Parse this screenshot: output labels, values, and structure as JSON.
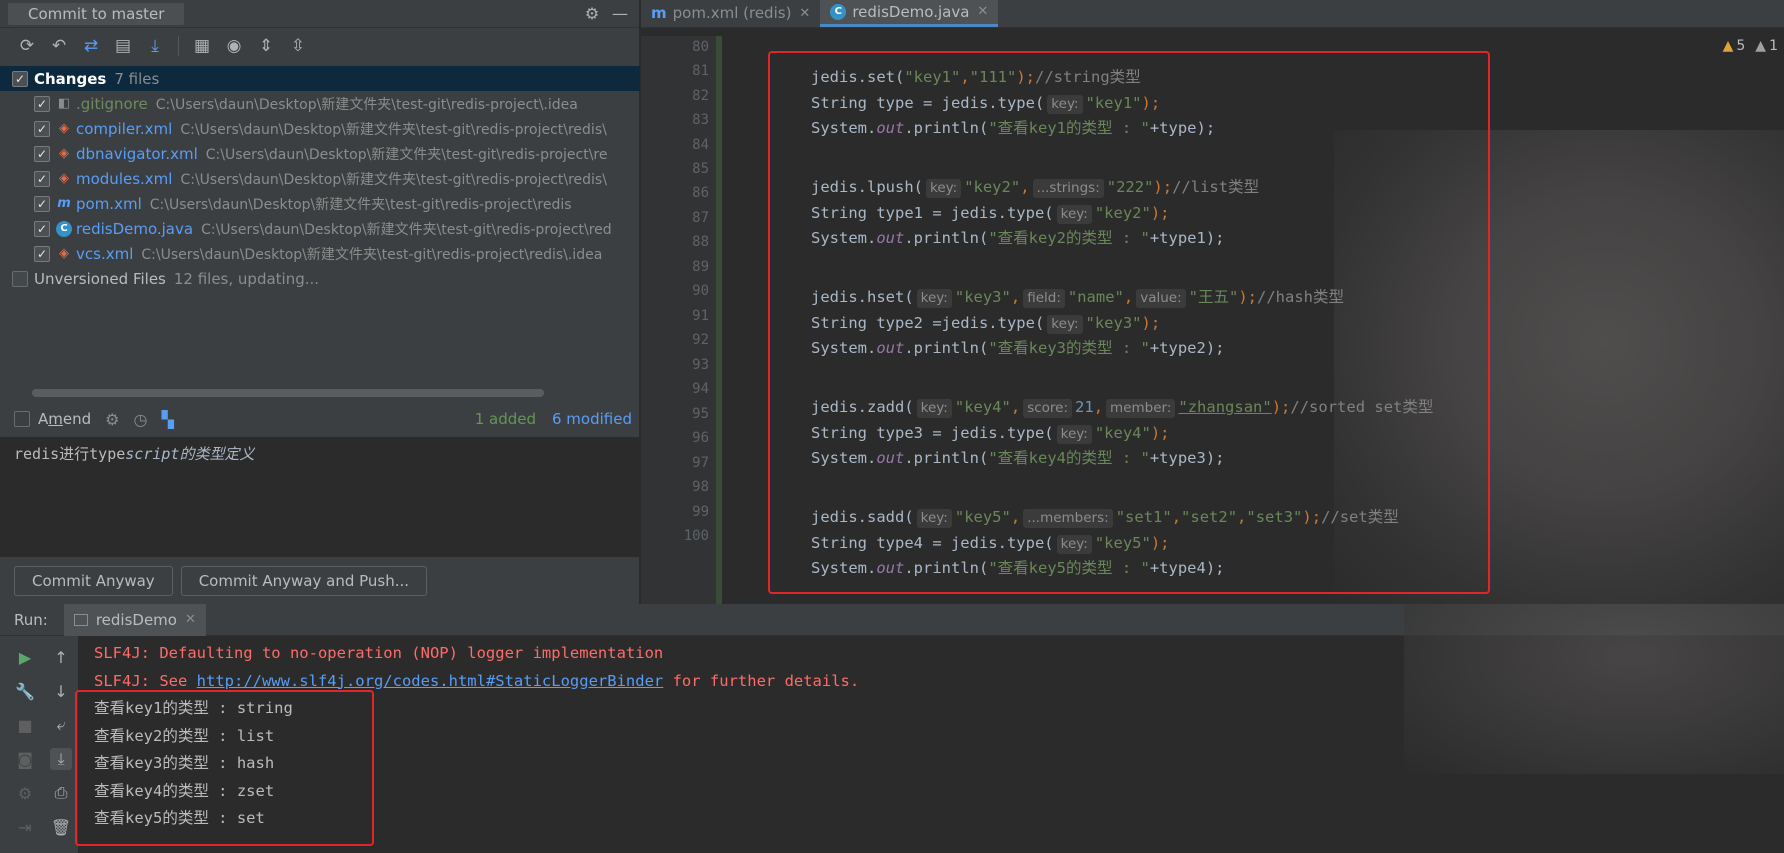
{
  "commit_panel": {
    "title": "Commit to master",
    "toolbar_icons": [
      "refresh-icon",
      "rollback-icon",
      "diff-icon",
      "shelve-icon",
      "download-icon",
      "group-icon",
      "eye-icon",
      "expand-icon",
      "collapse-icon"
    ],
    "changes_group": {
      "label": "Changes",
      "count": "7 files"
    },
    "files": [
      {
        "name": ".gitignore",
        "path": "C:\\Users\\daun\\Desktop\\新建文件夹\\test-git\\redis-project\\.idea",
        "icon": "gitignore-icon"
      },
      {
        "name": "compiler.xml",
        "path": "C:\\Users\\daun\\Desktop\\新建文件夹\\test-git\\redis-project\\redis\\",
        "icon": "xml-icon"
      },
      {
        "name": "dbnavigator.xml",
        "path": "C:\\Users\\daun\\Desktop\\新建文件夹\\test-git\\redis-project\\re",
        "icon": "xml-icon"
      },
      {
        "name": "modules.xml",
        "path": "C:\\Users\\daun\\Desktop\\新建文件夹\\test-git\\redis-project\\redis\\",
        "icon": "xml-icon"
      },
      {
        "name": "pom.xml",
        "path": "C:\\Users\\daun\\Desktop\\新建文件夹\\test-git\\redis-project\\redis",
        "icon": "maven-icon"
      },
      {
        "name": "redisDemo.java",
        "path": "C:\\Users\\daun\\Desktop\\新建文件夹\\test-git\\redis-project\\red",
        "icon": "java-class-icon"
      },
      {
        "name": "vcs.xml",
        "path": "C:\\Users\\daun\\Desktop\\新建文件夹\\test-git\\redis-project\\redis\\.idea",
        "icon": "xml-icon"
      }
    ],
    "unversioned": {
      "label": "Unversioned Files",
      "status": "12 files, updating..."
    },
    "amend_label": "Amend",
    "amend_mnemonic": "m",
    "stats": {
      "added": "1 added",
      "modified": "6 modified"
    },
    "message": {
      "plain": "redis进行type",
      "italic": "script的类型定义"
    },
    "buttons": {
      "commit_anyway": "Commit Anyway",
      "commit_and_push": "Commit Anyway and Push..."
    }
  },
  "editor": {
    "tabs": [
      {
        "label": "pom.xml (redis)",
        "active": false
      },
      {
        "label": "redisDemo.java",
        "active": true
      }
    ],
    "warnings": {
      "warn_count": "5",
      "weak_count": "1"
    },
    "line_numbers": [
      "80",
      "81",
      "82",
      "83",
      "84",
      "85",
      "86",
      "87",
      "88",
      "89",
      "90",
      "91",
      "92",
      "93",
      "94",
      "95",
      "96",
      "97",
      "98",
      "99",
      "100"
    ],
    "code": {
      "l81": {
        "a": "jedis.set(",
        "s1": "\"key1\"",
        "c": ",",
        "s2": "\"111\"",
        "e": ");",
        "cm": "//string类型"
      },
      "l82": {
        "a": "String type = jedis.type(",
        "h": "key:",
        "s": "\"key1\"",
        "e": ");"
      },
      "l83": {
        "a": "System.",
        "f": "out",
        "b": ".println(",
        "s": "\"查看key1的类型 : \"",
        "e": "+type);"
      },
      "l85": {
        "a": "jedis.lpush(",
        "h1": "key:",
        "s1": "\"key2\"",
        "c": ",",
        "h2": "...strings:",
        "s2": "\"222\"",
        "e": ");",
        "cm": "//list类型"
      },
      "l86": {
        "a": "String type1 = jedis.type(",
        "h": "key:",
        "s": "\"key2\"",
        "e": ");"
      },
      "l87": {
        "a": "System.",
        "f": "out",
        "b": ".println(",
        "s": "\"查看key2的类型 : \"",
        "e": "+type1);"
      },
      "l89": {
        "a": "jedis.hset(",
        "h1": "key:",
        "s1": "\"key3\"",
        "c1": ",",
        "h2": "field:",
        "s2": "\"name\"",
        "c2": ",",
        "h3": "value:",
        "s3": "\"王五\"",
        "e": ");",
        "cm": "//hash类型"
      },
      "l90": {
        "a": "String type2 =jedis.type(",
        "h": "key:",
        "s": "\"key3\"",
        "e": ");"
      },
      "l91": {
        "a": "System.",
        "f": "out",
        "b": ".println(",
        "s": "\"查看key3的类型 : \"",
        "e": "+type2);"
      },
      "l93": {
        "a": "jedis.zadd(",
        "h1": "key:",
        "s1": "\"key4\"",
        "c1": ",",
        "h2": "score:",
        "n": "21",
        "c2": ",",
        "h3": "member:",
        "s2": "\"zhangsan\"",
        "e": ");",
        "cm": "//sorted set类型"
      },
      "l94": {
        "a": "String type3 = jedis.type(",
        "h": "key:",
        "s": "\"key4\"",
        "e": ");"
      },
      "l95": {
        "a": "System.",
        "f": "out",
        "b": ".println(",
        "s": "\"查看key4的类型 : \"",
        "e": "+type3);"
      },
      "l97": {
        "a": "jedis.sadd(",
        "h1": "key:",
        "s1": "\"key5\"",
        "c1": ",",
        "h2": "...members:",
        "s2": "\"set1\"",
        "c2": ",",
        "s3": "\"set2\"",
        "c3": ",",
        "s4": "\"set3\"",
        "e": ");",
        "cm": "//set类型"
      },
      "l98": {
        "a": "String type4 = jedis.type(",
        "h": "key:",
        "s": "\"key5\"",
        "e": ");"
      },
      "l99": {
        "a": "System.",
        "f": "out",
        "b": ".println(",
        "s": "\"查看key5的类型 : \"",
        "e": "+type4);"
      }
    }
  },
  "run_panel": {
    "label": "Run:",
    "tab": "redisDemo",
    "console": {
      "slf1": "SLF4J: Defaulting to no-operation (NOP) logger implementation",
      "slf2_prefix": "SLF4J: See ",
      "slf2_link": "http://www.slf4j.org/codes.html#StaticLoggerBinder",
      "slf2_suffix": " for further details.",
      "outputs": [
        "查看key1的类型 : string",
        "查看key2的类型 : list",
        "查看key3的类型 : hash",
        "查看key4的类型 : zset",
        "查看key5的类型 : set"
      ]
    }
  },
  "colors": {
    "highlight_box": "#e0262a",
    "accent": "#589df6",
    "string": "#6a8759",
    "keyword": "#cc7832",
    "error_text": "#ff6b68"
  }
}
